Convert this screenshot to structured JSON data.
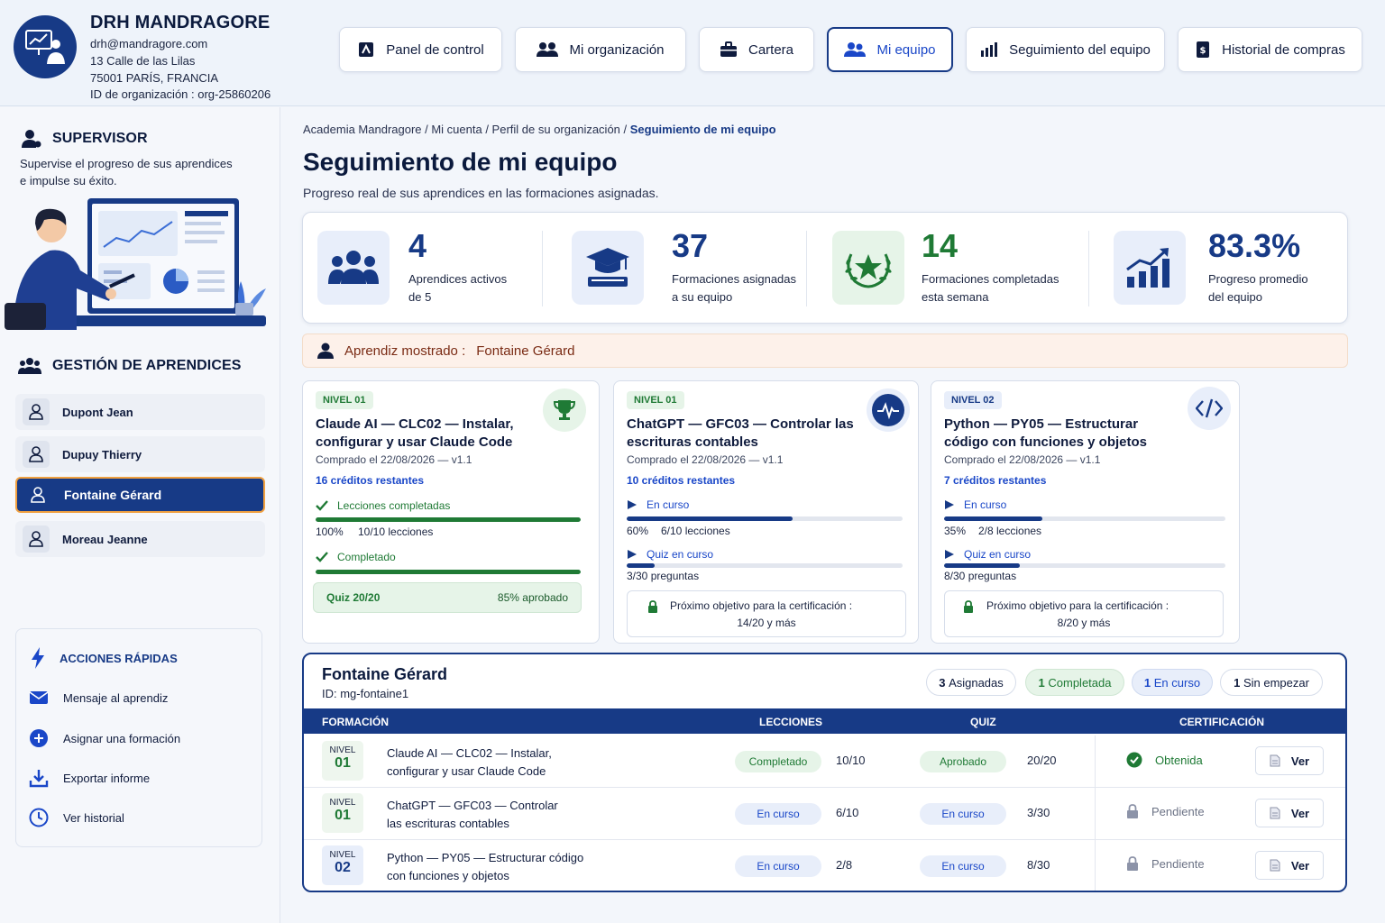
{
  "header": {
    "org_name": "DRH MANDRAGORE",
    "email": "drh@mandragore.com",
    "address1": "13 Calle de las Lilas",
    "address2": "75001 PARÍS, FRANCIA",
    "org_id": "ID de organización : org-25860206",
    "nav": [
      {
        "label": "Panel de control",
        "icon": "dashboard-icon"
      },
      {
        "label": "Mi organización",
        "icon": "users-icon"
      },
      {
        "label": "Cartera",
        "icon": "briefcase-icon"
      },
      {
        "label": "Mi equipo",
        "icon": "team-icon",
        "active": true
      },
      {
        "label": "Seguimiento del equipo",
        "icon": "bar-chart-icon"
      },
      {
        "label": "Historial de compras",
        "icon": "receipt-icon"
      }
    ]
  },
  "sidebar": {
    "supervisor_title": "SUPERVISOR",
    "supervisor_desc1": "Supervise el progreso de sus aprendices",
    "supervisor_desc2": "e impulse su éxito.",
    "learners_title": "GESTIÓN DE APRENDICES",
    "learners": [
      {
        "name": "Dupont Jean"
      },
      {
        "name": "Dupuy Thierry"
      },
      {
        "name": "Fontaine Gérard",
        "selected": true
      },
      {
        "name": "Moreau Jeanne"
      }
    ],
    "actions_title": "ACCIONES RÁPIDAS",
    "actions": [
      {
        "label": "Mensaje al aprendiz",
        "icon": "mail-icon"
      },
      {
        "label": "Asignar una formación",
        "icon": "plus-circle-icon"
      },
      {
        "label": "Exportar informe",
        "icon": "download-icon"
      },
      {
        "label": "Ver historial",
        "icon": "clock-icon"
      }
    ]
  },
  "breadcrumb": {
    "path": "Academia Mandragore / Mi cuenta / Perfil de su organización / ",
    "current": "Seguimiento de mi equipo"
  },
  "page": {
    "title": "Seguimiento de mi equipo",
    "subtitle": "Progreso real de sus aprendices en las formaciones asignadas."
  },
  "stats": [
    {
      "value": "4",
      "line1": "Aprendices activos",
      "line2": "de 5"
    },
    {
      "value": "37",
      "line1": "Formaciones asignadas",
      "line2": "a su equipo"
    },
    {
      "value": "14",
      "line1": "Formaciones completadas",
      "line2": "esta semana"
    },
    {
      "value": "83.3%",
      "line1": "Progreso promedio",
      "line2": "del equipo"
    }
  ],
  "shown": {
    "label": "Aprendiz mostrado :",
    "name": "Fontaine Gérard"
  },
  "cards": [
    {
      "level": "NIVEL 01",
      "title": "Claude AI — CLC02 — Instalar, configurar y usar Claude Code",
      "date": "Comprado el 22/08/2026 — v1.1",
      "credits": "16 créditos restantes",
      "lessons_status": "Lecciones completadas",
      "lessons_pct": "100%",
      "lessons_progress": 1.0,
      "lessons_count": "10/10 lecciones",
      "quiz_status": "Completado",
      "quiz_progress": 1.0,
      "quiz_score": "Quiz 20/20",
      "quiz_result": "85% aprobado"
    },
    {
      "level": "NIVEL 01",
      "title": "ChatGPT — GFC03 — Controlar las escrituras contables",
      "date": "Comprado el 22/08/2026 — v1.1",
      "credits": "10 créditos restantes",
      "lessons_status": "En curso",
      "lessons_pct": "60%",
      "lessons_progress": 0.6,
      "lessons_count": "6/10 lecciones",
      "quiz_status": "Quiz en curso",
      "quiz_progress": 0.1,
      "quiz_questions": "3/30 preguntas",
      "goal_line1": "Próximo objetivo para la certificación :",
      "goal_line2": "14/20 y más"
    },
    {
      "level": "NIVEL 02",
      "title": "Python — PY05 — Estructurar código con funciones y objetos",
      "date": "Comprado el 22/08/2026 — v1.1",
      "credits": "7 créditos restantes",
      "lessons_status": "En curso",
      "lessons_pct": "35%",
      "lessons_progress": 0.35,
      "lessons_count": "2/8 lecciones",
      "quiz_status": "Quiz en curso",
      "quiz_progress": 0.27,
      "quiz_questions": "8/30 preguntas",
      "goal_line1": "Próximo objetivo para la certificación :",
      "goal_line2": "8/20 y más"
    }
  ],
  "panel": {
    "name": "Fontaine Gérard",
    "id": "ID: mg-fontaine1",
    "pills": [
      {
        "count": "3",
        "label": "Asignadas"
      },
      {
        "count": "1",
        "label": "Completada"
      },
      {
        "count": "1",
        "label": "En curso"
      },
      {
        "count": "1",
        "label": "Sin empezar"
      }
    ],
    "headers": [
      "FORMACIÓN",
      "LECCIONES",
      "QUIZ",
      "CERTIFICACIÓN"
    ],
    "rows": [
      {
        "level_label": "NIVEL",
        "level_num": "01",
        "name1": "Claude AI — CLC02 — Instalar,",
        "name2": "configurar y usar Claude Code",
        "lessons_status": "Completado",
        "lessons": "10/10",
        "quiz_status": "Aprobado",
        "quiz": "20/20",
        "cert": "Obtenida",
        "view": "Ver"
      },
      {
        "level_label": "NIVEL",
        "level_num": "01",
        "name1": "ChatGPT — GFC03 — Controlar",
        "name2": "las escrituras contables",
        "lessons_status": "En curso",
        "lessons": "6/10",
        "quiz_status": "En curso",
        "quiz": "3/30",
        "cert": "Pendiente",
        "view": "Ver"
      },
      {
        "level_label": "NIVEL",
        "level_num": "02",
        "name1": "Python — PY05 — Estructurar código",
        "name2": "con funciones y objetos",
        "lessons_status": "En curso",
        "lessons": "2/8",
        "quiz_status": "En curso",
        "quiz": "8/30",
        "cert": "Pendiente",
        "view": "Ver"
      }
    ]
  },
  "colors": {
    "primary": "#173a86",
    "accent": "#1a47c8",
    "success": "#1f7a35",
    "warning_bg": "#fdf1ea"
  }
}
